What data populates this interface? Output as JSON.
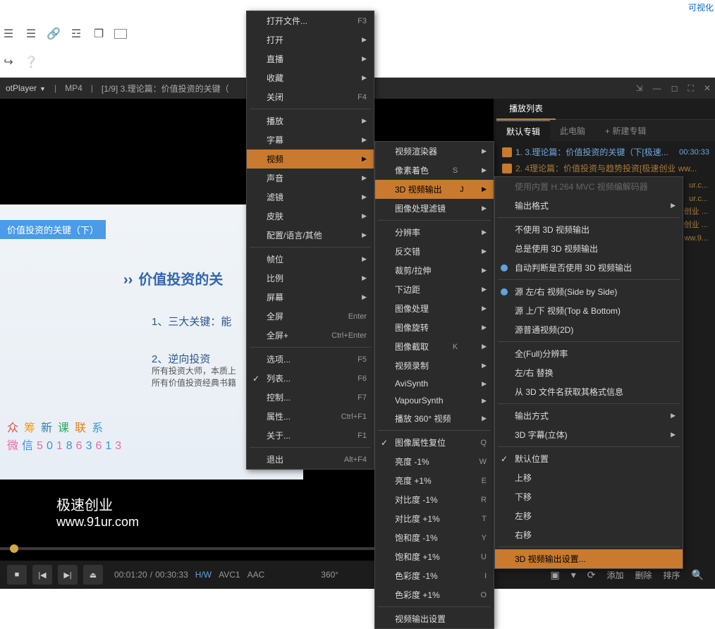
{
  "top": {
    "link": "可视化"
  },
  "title": {
    "app": "otPlayer",
    "fmt": "MP4",
    "track": "[1/9] 3.理论篇：价值投资的关键（",
    "ext": "mp4"
  },
  "winControls": {
    "pin": "⇲",
    "min": "—",
    "max": "◻",
    "full": "⛶",
    "close": "✕"
  },
  "video": {
    "blueTag": "价值投资的关键（下）",
    "headline": "价值投资的关",
    "b1": "1、三大关键：能",
    "b2": "2、逆向投资",
    "b2s1": "所有投资大师，本质上",
    "b2s2": "所有价值投资经典书籍",
    "rainbow1": "众筹新课联系",
    "rainbow2": "微信501863613",
    "wm1": "极速创业",
    "wm2": "www.91ur.com"
  },
  "controls": {
    "stop": "■",
    "prev": "|◀",
    "next": "▶|",
    "eject": "⏏",
    "cur": "00:01:20",
    "total": "00:30:33",
    "hw": "H/W",
    "vcodec": "AVC1",
    "acodec": "AAC",
    "deg": "360°",
    "add": "添加",
    "del": "删除",
    "sort": "排序"
  },
  "playlist": {
    "title": "播放列表",
    "tabs": {
      "default": "默认专辑",
      "pc": "此电脑",
      "new": "+ 新建专辑"
    },
    "items": [
      {
        "n": "1.",
        "t": "3.理论篇：价值投资的关键（下[极速...",
        "d": "00:30:33"
      },
      {
        "n": "2.",
        "t": "4理论篇：价值投资与趋势投资[极速创业 ww...",
        "d": ""
      }
    ],
    "trunc": [
      "ur.c...",
      "ur.c...",
      "创业 ...",
      "创业 ...",
      "ww.9..."
    ]
  },
  "menu1": [
    {
      "l": "打开文件...",
      "s": "F3"
    },
    {
      "l": "打开",
      "a": true
    },
    {
      "l": "直播",
      "a": true
    },
    {
      "l": "收藏",
      "a": true
    },
    {
      "l": "关闭",
      "s": "F4"
    },
    {
      "sep": true
    },
    {
      "l": "播放",
      "a": true
    },
    {
      "l": "字幕",
      "a": true
    },
    {
      "l": "视频",
      "a": true,
      "hi": true
    },
    {
      "l": "声音",
      "a": true
    },
    {
      "l": "滤镜",
      "a": true
    },
    {
      "l": "皮肤",
      "a": true
    },
    {
      "l": "配置/语言/其他",
      "a": true
    },
    {
      "sep": true
    },
    {
      "l": "帧位",
      "a": true
    },
    {
      "l": "比例",
      "a": true
    },
    {
      "l": "屏幕",
      "a": true
    },
    {
      "l": "全屏",
      "s": "Enter"
    },
    {
      "l": "全屏+",
      "s": "Ctrl+Enter"
    },
    {
      "sep": true
    },
    {
      "l": "选项...",
      "s": "F5"
    },
    {
      "l": "列表...",
      "s": "F6",
      "chk": true
    },
    {
      "l": "控制...",
      "s": "F7"
    },
    {
      "l": "属性...",
      "s": "Ctrl+F1"
    },
    {
      "l": "关于...",
      "s": "F1"
    },
    {
      "sep": true
    },
    {
      "l": "退出",
      "s": "Alt+F4"
    }
  ],
  "menu2": [
    {
      "l": "视频渲染器",
      "a": true
    },
    {
      "l": "像素着色",
      "s": "S",
      "a": true
    },
    {
      "l": "3D 视频输出",
      "s": "J",
      "a": true,
      "hi": true
    },
    {
      "l": "图像处理滤镜",
      "a": true
    },
    {
      "sep": true
    },
    {
      "l": "分辨率",
      "a": true
    },
    {
      "l": "反交错",
      "a": true
    },
    {
      "l": "裁剪/拉伸",
      "a": true
    },
    {
      "l": "下边距",
      "a": true
    },
    {
      "l": "图像处理",
      "a": true
    },
    {
      "l": "图像旋转",
      "a": true
    },
    {
      "l": "图像截取",
      "s": "K",
      "a": true
    },
    {
      "l": "视频录制",
      "a": true
    },
    {
      "l": "AviSynth",
      "a": true
    },
    {
      "l": "VapourSynth",
      "a": true
    },
    {
      "l": "播放 360° 视频",
      "a": true
    },
    {
      "sep": true
    },
    {
      "l": "图像属性复位",
      "s": "Q",
      "chk": true
    },
    {
      "l": "亮度 -1%",
      "s": "W"
    },
    {
      "l": "亮度 +1%",
      "s": "E"
    },
    {
      "l": "对比度 -1%",
      "s": "R"
    },
    {
      "l": "对比度 +1%",
      "s": "T"
    },
    {
      "l": "饱和度 -1%",
      "s": "Y"
    },
    {
      "l": "饱和度 +1%",
      "s": "U"
    },
    {
      "l": "色彩度 -1%",
      "s": "I"
    },
    {
      "l": "色彩度 +1%",
      "s": "O"
    },
    {
      "sep": true
    },
    {
      "l": "视频输出设置"
    }
  ],
  "menu3": [
    {
      "l": "使用内置 H.264 MVC 视频编解码器",
      "dis": true
    },
    {
      "l": "输出格式",
      "a": true
    },
    {
      "sep": true
    },
    {
      "l": "不使用 3D 视频输出"
    },
    {
      "l": "总是使用 3D 视频输出"
    },
    {
      "l": "自动判断是否使用 3D 视频输出",
      "radio": true
    },
    {
      "sep": true
    },
    {
      "l": "源 左/右 视频(Side by Side)",
      "radio": true
    },
    {
      "l": "源 上/下 视频(Top & Bottom)"
    },
    {
      "l": "源普通视频(2D)"
    },
    {
      "sep": true
    },
    {
      "l": "全(Full)分辨率"
    },
    {
      "l": "左/右 替换"
    },
    {
      "l": "从 3D 文件名获取其格式信息"
    },
    {
      "sep": true
    },
    {
      "l": "输出方式",
      "a": true
    },
    {
      "l": "3D 字幕(立体)",
      "a": true
    },
    {
      "sep": true
    },
    {
      "l": "默认位置",
      "chk": true
    },
    {
      "l": "上移"
    },
    {
      "l": "下移"
    },
    {
      "l": "左移"
    },
    {
      "l": "右移"
    },
    {
      "sep": true
    },
    {
      "l": "3D 视频输出设置...",
      "hi": true
    }
  ]
}
